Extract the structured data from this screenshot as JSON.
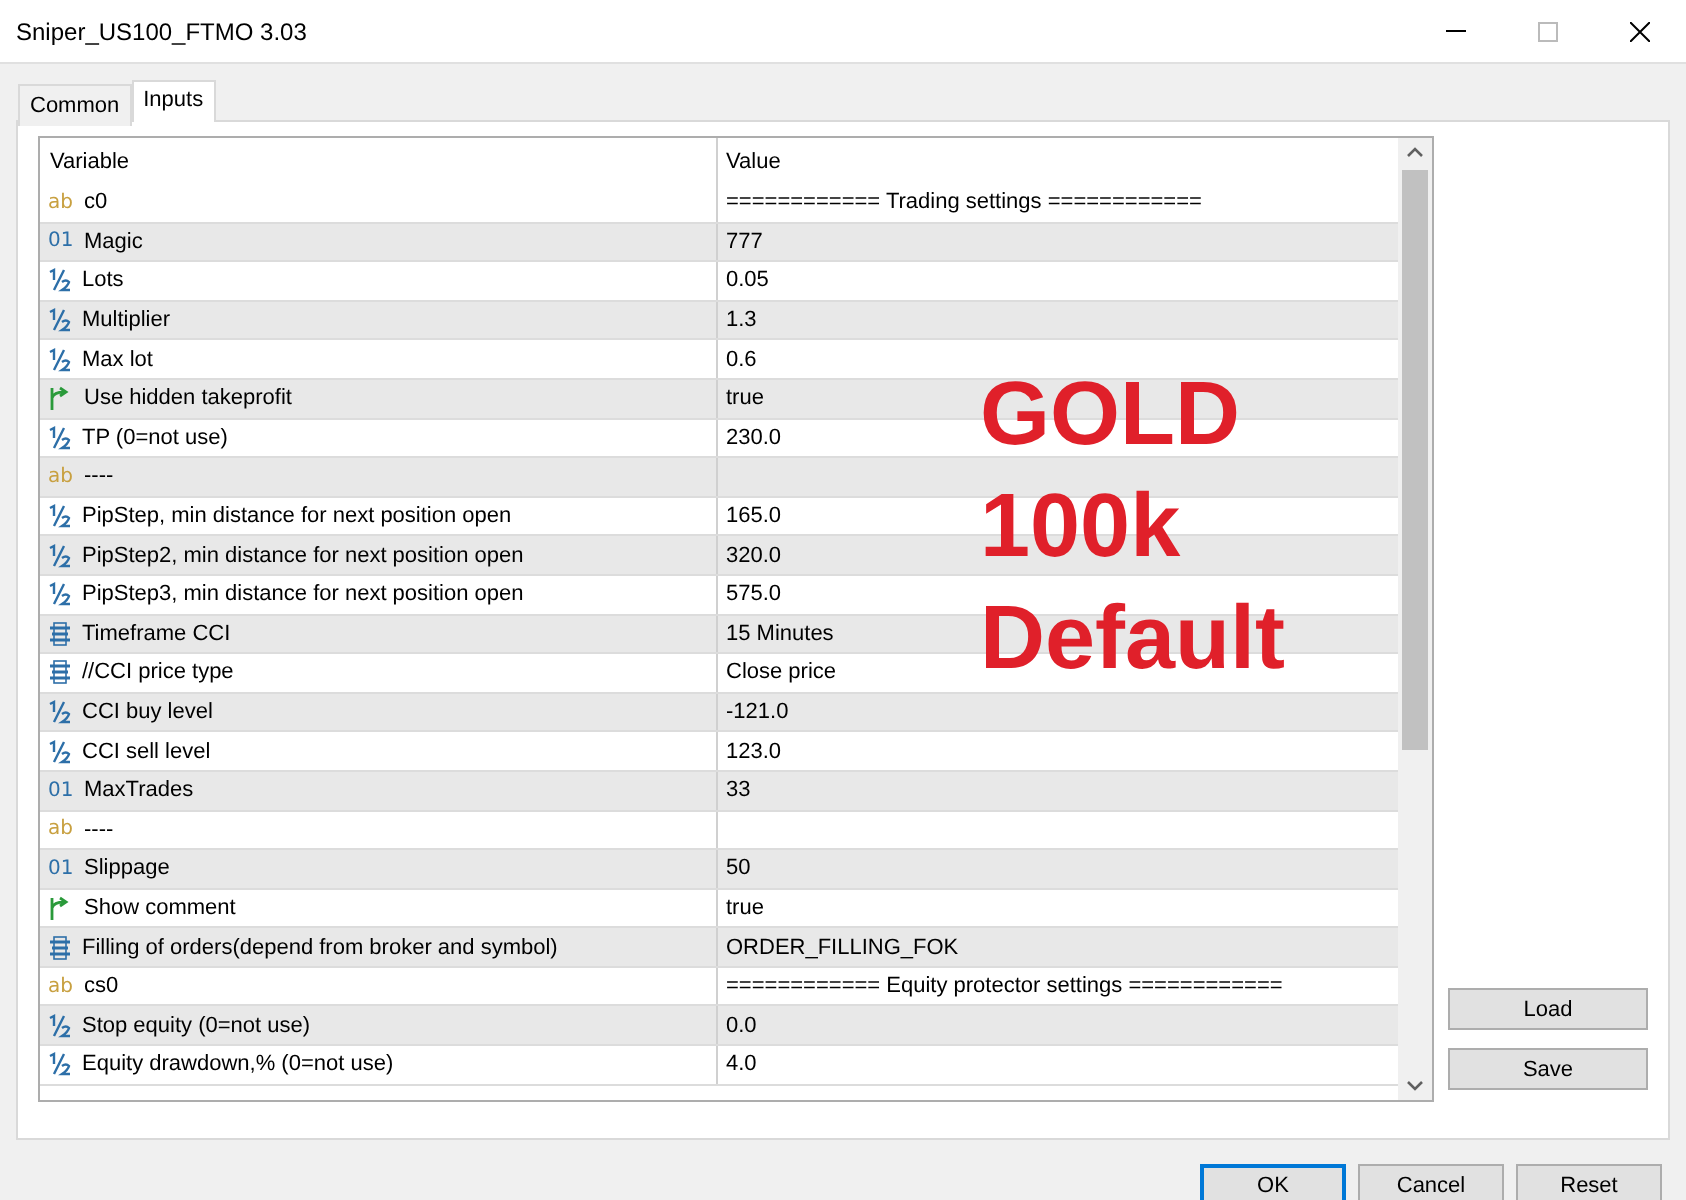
{
  "window": {
    "title": "Sniper_US100_FTMO 3.03"
  },
  "tabs": [
    {
      "label": "Common",
      "selected": false
    },
    {
      "label": "Inputs",
      "selected": true
    }
  ],
  "table": {
    "columns": [
      "Variable",
      "Value"
    ],
    "rows": [
      {
        "kind": "string",
        "icon": "ab",
        "variable": "c0",
        "value": "============ Trading settings ============"
      },
      {
        "kind": "int",
        "icon": "01",
        "variable": "Magic",
        "value": "777"
      },
      {
        "kind": "double",
        "variable": "Lots",
        "value": "0.05"
      },
      {
        "kind": "double",
        "variable": "Multiplier",
        "value": "1.3"
      },
      {
        "kind": "double",
        "variable": "Max lot",
        "value": "0.6"
      },
      {
        "kind": "bool",
        "variable": "Use hidden takeprofit",
        "value": "true"
      },
      {
        "kind": "double",
        "variable": "TP (0=not use)",
        "value": "230.0"
      },
      {
        "kind": "string",
        "icon": "ab",
        "variable": "----",
        "value": ""
      },
      {
        "kind": "double",
        "variable": "PipStep, min distance for next position open",
        "value": "165.0"
      },
      {
        "kind": "double",
        "variable": "PipStep2, min distance for next position open",
        "value": "320.0"
      },
      {
        "kind": "double",
        "variable": "PipStep3, min distance for next position open",
        "value": "575.0"
      },
      {
        "kind": "enum",
        "variable": "Timeframe CCI",
        "value": "15 Minutes"
      },
      {
        "kind": "enum",
        "variable": "//CCI price type",
        "value": "Close price"
      },
      {
        "kind": "double",
        "variable": "CCI buy level",
        "value": "-121.0"
      },
      {
        "kind": "double",
        "variable": "CCI sell level",
        "value": "123.0"
      },
      {
        "kind": "int",
        "icon": "01",
        "variable": "MaxTrades",
        "value": "33"
      },
      {
        "kind": "string",
        "icon": "ab",
        "variable": "----",
        "value": ""
      },
      {
        "kind": "int",
        "icon": "01",
        "variable": "Slippage",
        "value": "50"
      },
      {
        "kind": "bool",
        "variable": "Show comment",
        "value": "true"
      },
      {
        "kind": "enum",
        "variable": "Filling of orders(depend from broker and symbol)",
        "value": "ORDER_FILLING_FOK"
      },
      {
        "kind": "string",
        "icon": "ab",
        "variable": "cs0",
        "value": "============ Equity protector settings ============"
      },
      {
        "kind": "double",
        "variable": "Stop equity (0=not use)",
        "value": "0.0"
      },
      {
        "kind": "double",
        "variable": "Equity drawdown,% (0=not use)",
        "value": "4.0"
      }
    ]
  },
  "overlay": [
    "GOLD",
    "100k",
    "Default"
  ],
  "side_buttons": [
    "Load",
    "Save"
  ],
  "buttons": [
    "OK",
    "Cancel",
    "Reset"
  ]
}
